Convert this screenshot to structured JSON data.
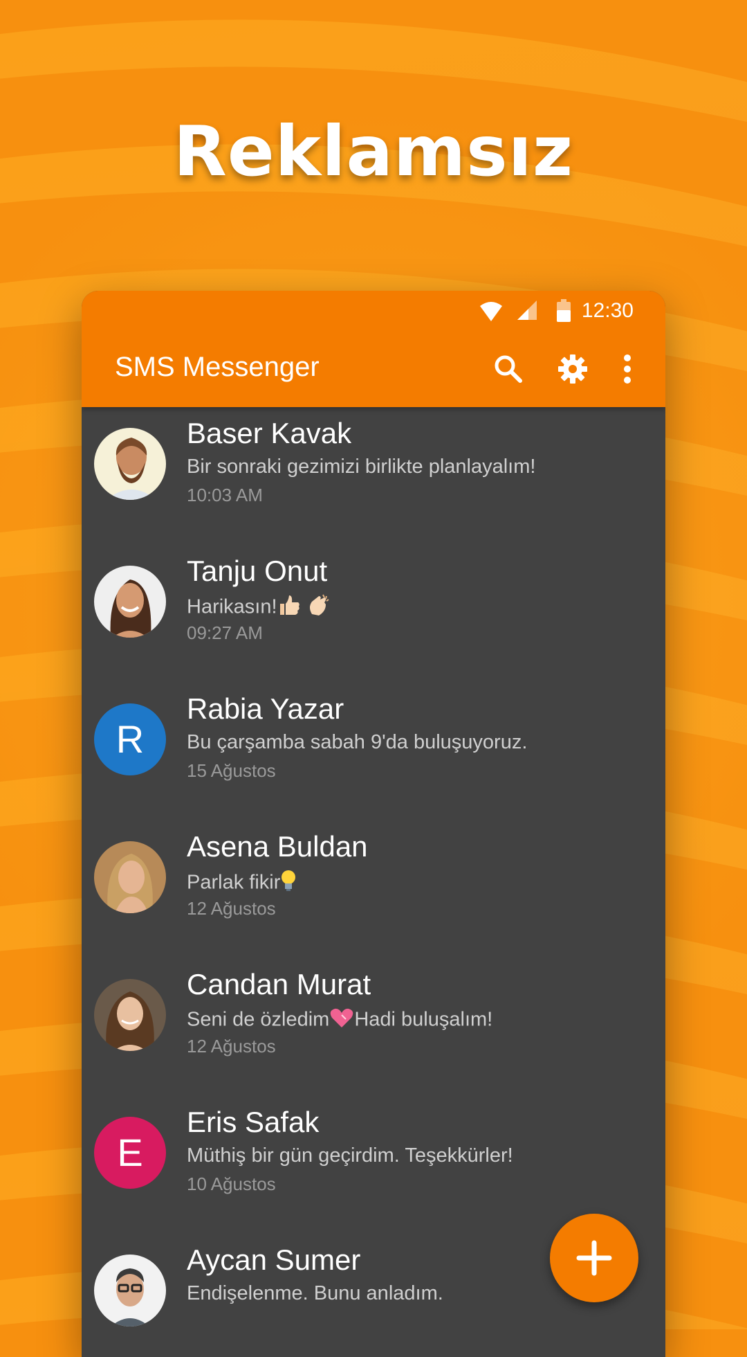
{
  "promo": {
    "headline": "Reklamsız"
  },
  "status_bar": {
    "time": "12:30"
  },
  "toolbar": {
    "title": "SMS Messenger",
    "icons": [
      "search-icon",
      "settings-gear-icon",
      "more-vert-icon"
    ]
  },
  "colors": {
    "accent": "#f47c00",
    "background": "#f7900f",
    "list_background": "#424242",
    "avatar_blue": "#1e78c8",
    "avatar_pink": "#d81b60"
  },
  "conversations": [
    {
      "name": "Baser Kavak",
      "message": "Bir sonraki gezimizi birlikte planlayalım!",
      "date": "10:03 AM",
      "avatar": "photo"
    },
    {
      "name": "Tanju Onut",
      "message": "Harikasın!",
      "message_emoji": "thumbs-up-and-clapping-hands-emoji",
      "date": "09:27 AM",
      "avatar": "photo"
    },
    {
      "name": "Rabia Yazar",
      "message": "Bu çarşamba sabah 9'da buluşuyoruz.",
      "date": "15 Ağustos",
      "avatar": "letter",
      "avatar_letter": "R"
    },
    {
      "name": "Asena Buldan",
      "message": "Parlak fikir",
      "message_emoji": "light-bulb-emoji",
      "date": "12 Ağustos",
      "avatar": "photo"
    },
    {
      "name": "Candan Murat",
      "message_before": "Seni de özledim",
      "message_emoji": "heart-emoji",
      "message_after": "Hadi buluşalım!",
      "date": "12 Ağustos",
      "avatar": "photo"
    },
    {
      "name": "Eris Safak",
      "message": "Müthiş bir gün geçirdim. Teşekkürler!",
      "date": "10 Ağustos",
      "avatar": "letter",
      "avatar_letter": "E"
    },
    {
      "name": "Aycan Sumer",
      "message": "Endişelenme. Bunu anladım.",
      "date": "",
      "avatar": "photo"
    }
  ],
  "fab": {
    "icon": "plus-icon"
  }
}
